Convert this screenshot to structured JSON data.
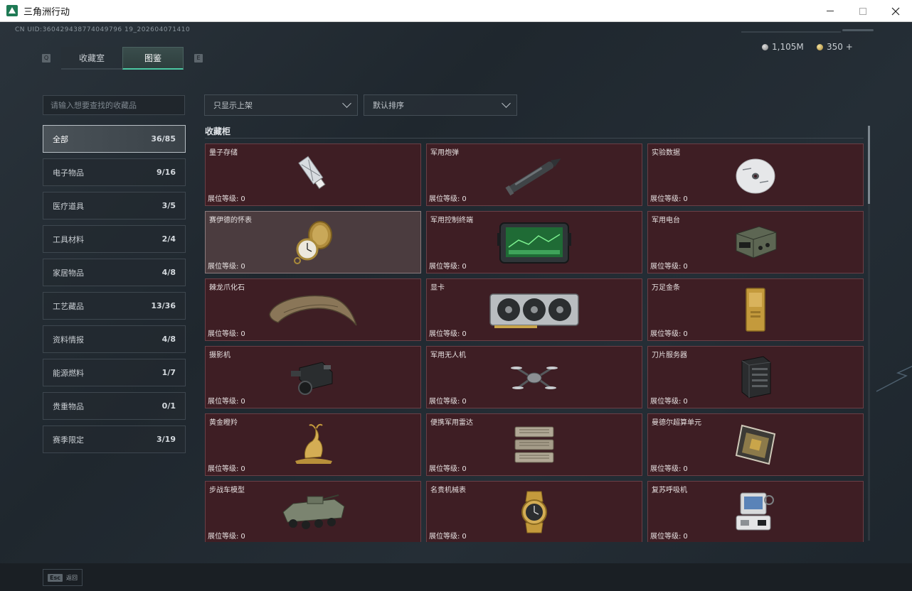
{
  "window": {
    "title": "三角洲行动"
  },
  "header": {
    "uid": "CN UID:360429438774049796 19_202604071410",
    "tab_left_key": "Q",
    "tab_right_key": "E",
    "tabs": [
      {
        "label": "收藏室",
        "active": false
      },
      {
        "label": "图鉴",
        "active": true
      }
    ],
    "currency": [
      {
        "type": "silver",
        "value": "1,105M"
      },
      {
        "type": "gold",
        "value": "350 +"
      }
    ]
  },
  "search": {
    "placeholder": "请输入想要查找的收藏品"
  },
  "categories": [
    {
      "label": "全部",
      "count": "36/85",
      "active": true
    },
    {
      "label": "电子物品",
      "count": "9/16"
    },
    {
      "label": "医疗道具",
      "count": "3/5"
    },
    {
      "label": "工具材料",
      "count": "2/4"
    },
    {
      "label": "家居物品",
      "count": "4/8"
    },
    {
      "label": "工艺藏品",
      "count": "13/36"
    },
    {
      "label": "资料情报",
      "count": "4/8"
    },
    {
      "label": "能源燃料",
      "count": "1/7"
    },
    {
      "label": "贵重物品",
      "count": "0/1"
    },
    {
      "label": "赛季限定",
      "count": "3/19"
    }
  ],
  "filters": {
    "display": "只显示上架",
    "sort": "默认排序"
  },
  "section": {
    "title": "收藏柜"
  },
  "level_label": "展位等级:",
  "items": [
    {
      "name": "量子存储",
      "level": "0",
      "icon": "usb-drive-icon"
    },
    {
      "name": "军用炮弹",
      "level": "0",
      "icon": "artillery-shell-icon"
    },
    {
      "name": "实验数据",
      "level": "0",
      "icon": "data-disc-icon"
    },
    {
      "name": "赛伊德的怀表",
      "level": "0",
      "icon": "pocket-watch-icon"
    },
    {
      "name": "军用控制终端",
      "level": "0",
      "icon": "control-terminal-icon"
    },
    {
      "name": "军用电台",
      "level": "0",
      "icon": "military-radio-icon"
    },
    {
      "name": "棘龙爪化石",
      "level": "0",
      "icon": "claw-fossil-icon"
    },
    {
      "name": "显卡",
      "level": "0",
      "icon": "graphics-card-icon"
    },
    {
      "name": "万足金条",
      "level": "0",
      "icon": "gold-bar-icon"
    },
    {
      "name": "摄影机",
      "level": "0",
      "icon": "camera-icon"
    },
    {
      "name": "军用无人机",
      "level": "0",
      "icon": "drone-icon"
    },
    {
      "name": "刀片服务器",
      "level": "0",
      "icon": "blade-server-icon"
    },
    {
      "name": "黄金瞪羚",
      "level": "0",
      "icon": "golden-gazelle-icon"
    },
    {
      "name": "便携军用雷达",
      "level": "0",
      "icon": "portable-radar-icon"
    },
    {
      "name": "曼德尔超算单元",
      "level": "0",
      "icon": "compute-unit-icon"
    },
    {
      "name": "步战车模型",
      "level": "0",
      "icon": "ifv-model-icon"
    },
    {
      "name": "名贵机械表",
      "level": "0",
      "icon": "wristwatch-icon"
    },
    {
      "name": "复苏呼吸机",
      "level": "0",
      "icon": "ventilator-icon"
    }
  ],
  "footer": {
    "esc_key": "Esc",
    "esc_label": "返回"
  },
  "colors": {
    "accent": "#4cc9a3",
    "card_bg": "#3e1e24",
    "card_border": "#6a3f46",
    "background": "#1f272e"
  }
}
